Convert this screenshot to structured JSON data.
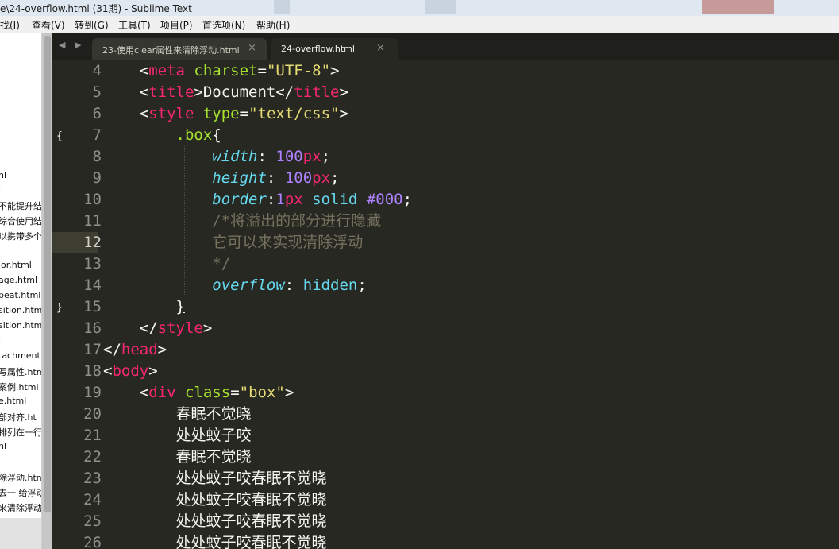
{
  "window": {
    "title": "e\\24-overflow.html (31期) - Sublime Text"
  },
  "menu": [
    "找(I)",
    "查看(V)",
    "转到(G)",
    "工具(T)",
    "项目(P)",
    "首选项(N)",
    "帮助(H)"
  ],
  "sidebar": {
    "files": [
      "nl",
      "l",
      "不能提升结",
      "综合使用结",
      "以携带多个",
      "lor.html",
      "age.html",
      "peat.html",
      "sition.htm",
      "sition.htm",
      "l",
      "tachment.",
      "写属性.htm",
      "案例.html",
      "e.html",
      "部对齐.ht",
      "排列在一行",
      "nl",
      "除浮动.htm",
      "去一 给浮动",
      "来清除浮动"
    ]
  },
  "tabs": {
    "nav": "◀ ▶",
    "items": [
      {
        "label": "23-使用clear属性来清除浮动.html",
        "close": "×"
      },
      {
        "label": "24-overflow.html",
        "close": "×"
      }
    ]
  },
  "editor": {
    "current_line": "12",
    "fold_open": "{",
    "fold_close": "}",
    "lines": [
      {
        "n": "4",
        "t": [
          [
            "t-txt",
            "    <"
          ],
          [
            "t-tag",
            "meta"
          ],
          [
            "t-txt",
            " "
          ],
          [
            "t-attr",
            "charset"
          ],
          [
            "t-txt",
            "="
          ],
          [
            "t-str",
            "\"UTF-8\""
          ],
          [
            "t-txt",
            ">"
          ]
        ]
      },
      {
        "n": "5",
        "t": [
          [
            "t-txt",
            "    <"
          ],
          [
            "t-tag",
            "title"
          ],
          [
            "t-txt",
            ">Document</"
          ],
          [
            "t-tag",
            "title"
          ],
          [
            "t-txt",
            ">"
          ]
        ]
      },
      {
        "n": "6",
        "t": [
          [
            "t-txt",
            "    <"
          ],
          [
            "t-tag",
            "style"
          ],
          [
            "t-txt",
            " "
          ],
          [
            "t-attr",
            "type"
          ],
          [
            "t-txt",
            "="
          ],
          [
            "t-str",
            "\"text/css\""
          ],
          [
            "t-txt",
            ">"
          ]
        ]
      },
      {
        "n": "7",
        "t": [
          [
            "t-txt",
            "        "
          ],
          [
            "t-sel",
            ".box"
          ],
          [
            "t-brace",
            "{"
          ]
        ]
      },
      {
        "n": "8",
        "t": [
          [
            "t-txt",
            "            "
          ],
          [
            "t-prop",
            "width"
          ],
          [
            "t-txt",
            ": "
          ],
          [
            "t-num",
            "100"
          ],
          [
            "t-unit",
            "px"
          ],
          [
            "t-txt",
            ";"
          ]
        ]
      },
      {
        "n": "9",
        "t": [
          [
            "t-txt",
            "            "
          ],
          [
            "t-prop",
            "height"
          ],
          [
            "t-txt",
            ": "
          ],
          [
            "t-num",
            "100"
          ],
          [
            "t-unit",
            "px"
          ],
          [
            "t-txt",
            ";"
          ]
        ]
      },
      {
        "n": "10",
        "t": [
          [
            "t-txt",
            "            "
          ],
          [
            "t-prop",
            "border"
          ],
          [
            "t-txt",
            ":"
          ],
          [
            "t-num",
            "1"
          ],
          [
            "t-unit",
            "px"
          ],
          [
            "t-txt",
            " "
          ],
          [
            "t-val",
            "solid"
          ],
          [
            "t-txt",
            " "
          ],
          [
            "t-num",
            "#000"
          ],
          [
            "t-txt",
            ";"
          ]
        ]
      },
      {
        "n": "11",
        "t": [
          [
            "t-txt",
            "            "
          ],
          [
            "t-com",
            "/*将溢出的部分进行隐藏"
          ]
        ]
      },
      {
        "n": "12",
        "t": [
          [
            "t-txt",
            "            "
          ],
          [
            "t-com",
            "它可以来实现清除浮动"
          ]
        ]
      },
      {
        "n": "13",
        "t": [
          [
            "t-txt",
            "            "
          ],
          [
            "t-com",
            "*/"
          ]
        ]
      },
      {
        "n": "14",
        "t": [
          [
            "t-txt",
            "            "
          ],
          [
            "t-prop",
            "overflow"
          ],
          [
            "t-txt",
            ": "
          ],
          [
            "t-val",
            "hidden"
          ],
          [
            "t-txt",
            ";"
          ]
        ]
      },
      {
        "n": "15",
        "t": [
          [
            "t-txt",
            "        "
          ],
          [
            "t-brace",
            "}"
          ]
        ]
      },
      {
        "n": "16",
        "t": [
          [
            "t-txt",
            "    </"
          ],
          [
            "t-tag",
            "style"
          ],
          [
            "t-txt",
            ">"
          ]
        ]
      },
      {
        "n": "17",
        "t": [
          [
            "t-txt",
            "</"
          ],
          [
            "t-tag",
            "head"
          ],
          [
            "t-txt",
            ">"
          ]
        ]
      },
      {
        "n": "18",
        "t": [
          [
            "t-txt",
            "<"
          ],
          [
            "t-tag",
            "body"
          ],
          [
            "t-txt",
            ">"
          ]
        ]
      },
      {
        "n": "19",
        "t": [
          [
            "t-txt",
            "    <"
          ],
          [
            "t-tag",
            "div"
          ],
          [
            "t-txt",
            " "
          ],
          [
            "t-attr",
            "class"
          ],
          [
            "t-txt",
            "="
          ],
          [
            "t-str",
            "\"box\""
          ],
          [
            "t-txt",
            ">"
          ]
        ]
      },
      {
        "n": "20",
        "t": [
          [
            "t-txt",
            "        春眠不觉晓"
          ]
        ]
      },
      {
        "n": "21",
        "t": [
          [
            "t-txt",
            "        处处蚊子咬"
          ]
        ]
      },
      {
        "n": "22",
        "t": [
          [
            "t-txt",
            "        春眠不觉晓"
          ]
        ]
      },
      {
        "n": "23",
        "t": [
          [
            "t-txt",
            "        处处蚊子咬春眠不觉晓"
          ]
        ]
      },
      {
        "n": "24",
        "t": [
          [
            "t-txt",
            "        处处蚊子咬春眠不觉晓"
          ]
        ]
      },
      {
        "n": "25",
        "t": [
          [
            "t-txt",
            "        处处蚊子咬春眠不觉晓"
          ]
        ]
      },
      {
        "n": "26",
        "t": [
          [
            "t-txt",
            "        处处蚊子咬春眠不觉晓"
          ]
        ]
      }
    ]
  }
}
